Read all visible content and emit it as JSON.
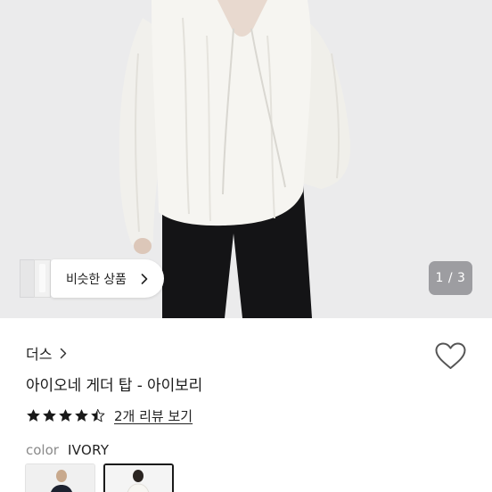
{
  "gallery": {
    "similar_label": "비슷한 상품",
    "counter": "1 / 3"
  },
  "product": {
    "brand": "더스",
    "title": "아이오네 게더 탑 - 아이보리",
    "rating": 4.5,
    "review_link": "2개 리뷰 보기",
    "color_label": "color",
    "color_value": "IVORY"
  },
  "icons": {
    "similar": "chevron-right-icon",
    "brand": "chevron-right-icon",
    "wishlist": "heart-outline-icon",
    "star": "star-icon"
  },
  "colors": {
    "photo_background": "#ebebec",
    "star": "#1a1a1a"
  }
}
